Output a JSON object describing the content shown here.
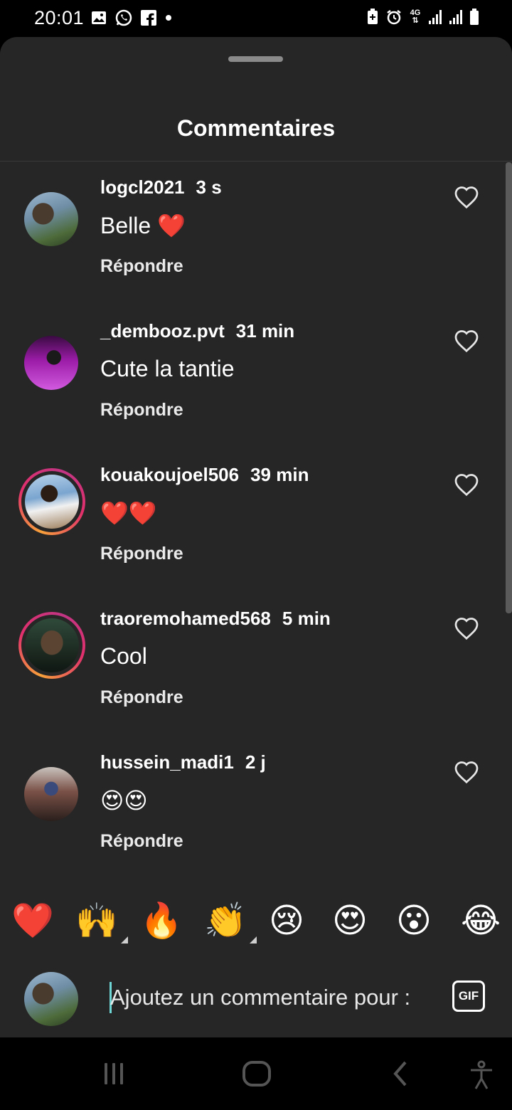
{
  "status": {
    "time": "20:01",
    "left_icons": [
      "gallery-icon",
      "whatsapp-icon",
      "facebook-icon",
      "dot-icon"
    ],
    "right_icons": [
      "battery-saver-icon",
      "alarm-icon",
      "network-4g-icon",
      "signal-icon",
      "signal-icon",
      "battery-icon"
    ],
    "network_label": "4G"
  },
  "sheet": {
    "title": "Commentaires"
  },
  "comments": [
    {
      "username": "logcl2021",
      "time": "3 s",
      "text": "Belle ❤️",
      "reply": "Répondre",
      "has_story_ring": false
    },
    {
      "username": "_dembooz.pvt",
      "time": "31 min",
      "text": "Cute la tantie",
      "reply": "Répondre",
      "has_story_ring": false
    },
    {
      "username": "kouakoujoel506",
      "time": "39 min",
      "text": "❤️❤️",
      "reply": "Répondre",
      "has_story_ring": true
    },
    {
      "username": "traoremohamed568",
      "time": "5 min",
      "text": "Cool",
      "reply": "Répondre",
      "has_story_ring": true
    },
    {
      "username": "hussein_madi1",
      "time": "2 j",
      "text": "😍😍",
      "reply": "Répondre",
      "has_story_ring": false
    }
  ],
  "quick_emojis": [
    "❤️",
    "🙌",
    "🔥",
    "👏",
    "😢",
    "😍",
    "😮",
    "😂"
  ],
  "compose": {
    "placeholder": "Ajoutez un commentaire pour :",
    "gif_label": "GIF"
  },
  "navbar": [
    "recent-apps-icon",
    "home-icon",
    "back-icon",
    "accessibility-icon"
  ],
  "colors": {
    "sheet_bg": "#262626",
    "story_ring_start": "#f7a13a",
    "story_ring_end": "#c13584"
  }
}
